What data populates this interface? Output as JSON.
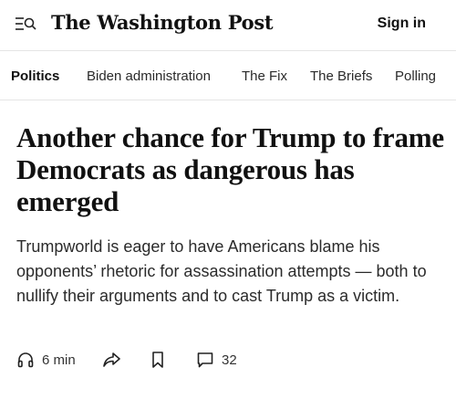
{
  "header": {
    "menu_icon": "hamburger-search-icon",
    "logo_text": "The Washington Post",
    "signin_label": "Sign in"
  },
  "nav": {
    "items": [
      {
        "label": "Politics",
        "active": true
      },
      {
        "label": "Biden administration",
        "active": false
      },
      {
        "label": "The Fix",
        "active": false
      },
      {
        "label": "The Briefs",
        "active": false
      },
      {
        "label": "Polling",
        "active": false
      }
    ]
  },
  "article": {
    "headline": "Another chance for Trump to frame Democrats as dangerous has emerged",
    "dek": "Trumpworld is eager to have Americans blame his opponents’ rhetoric for assassination attempts — both to nullify their arguments and to cast Trump as a victim."
  },
  "actions": {
    "listen_icon": "headphones-icon",
    "listen_label": "6 min",
    "share_icon": "share-arrow-icon",
    "save_icon": "bookmark-icon",
    "comments_icon": "comment-icon",
    "comments_count": "32"
  },
  "colors": {
    "text": "#111111",
    "divider": "#e5e5e5",
    "background": "#ffffff"
  }
}
